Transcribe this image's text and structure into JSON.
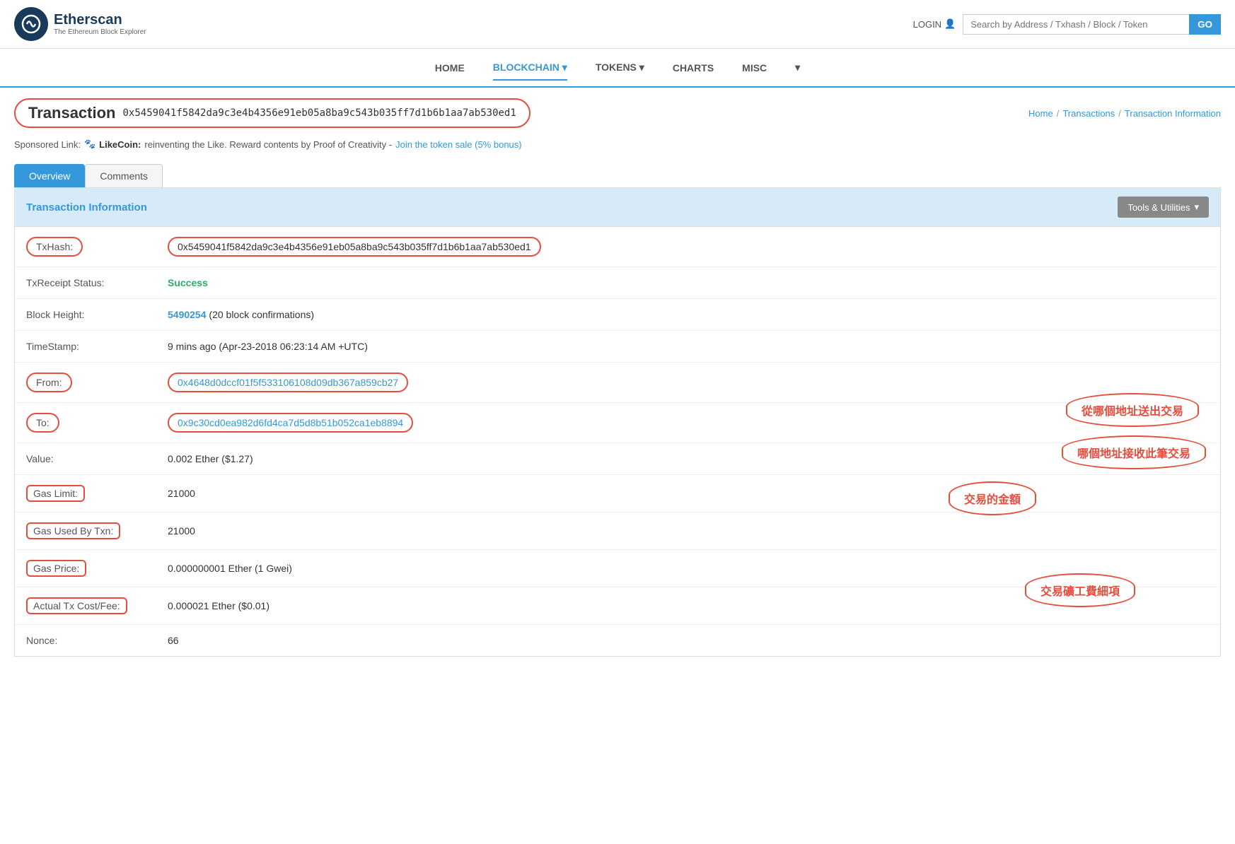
{
  "header": {
    "logo_title": "Etherscan",
    "logo_subtitle": "The Ethereum Block Explorer",
    "login_label": "LOGIN",
    "search_placeholder": "Search by Address / Txhash / Block / Token",
    "search_go": "GO"
  },
  "nav": {
    "items": [
      {
        "label": "HOME",
        "active": false
      },
      {
        "label": "BLOCKCHAIN ▾",
        "active": true
      },
      {
        "label": "TOKENS ▾",
        "active": false
      },
      {
        "label": "CHARTS",
        "active": false
      },
      {
        "label": "MISC",
        "active": false
      },
      {
        "label": "▾",
        "active": false
      }
    ]
  },
  "transaction": {
    "label": "Transaction",
    "hash": "0x5459041f5842da9c3e4b4356e91eb05a8ba9c543b035ff7d1b6b1aa7ab530ed1"
  },
  "breadcrumb": {
    "home": "Home",
    "transactions": "Transactions",
    "current": "Transaction Information"
  },
  "sponsored": {
    "prefix": "Sponsored Link:",
    "coin_name": "LikeCoin:",
    "description": " reinventing the Like. Reward contents by Proof of Creativity -",
    "cta": " Join the token sale (5% bonus)"
  },
  "tabs": [
    {
      "label": "Overview",
      "active": true
    },
    {
      "label": "Comments",
      "active": false
    }
  ],
  "info_panel": {
    "title": "Transaction Information",
    "tools_label": "Tools & Utilities",
    "tools_icon": "▾"
  },
  "tx_fields": {
    "txhash_label": "TxHash:",
    "txhash_value": "0x5459041f5842da9c3e4b4356e91eb05a8ba9c543b035ff7d1b6b1aa7ab530ed1",
    "status_label": "TxReceipt Status:",
    "status_value": "Success",
    "block_label": "Block Height:",
    "block_value": "5490254",
    "block_confirmations": "(20 block confirmations)",
    "timestamp_label": "TimeStamp:",
    "timestamp_value": "9 mins ago (Apr-23-2018 06:23:14 AM +UTC)",
    "from_label": "From:",
    "from_value": "0x4648d0dccf01f5f533106108d09db367a859cb27",
    "to_label": "To:",
    "to_value": "0x9c30cd0ea982d6fd4ca7d5d8b51b052ca1eb8894",
    "value_label": "Value:",
    "value_value": "0.002 Ether ($1.27)",
    "gas_limit_label": "Gas Limit:",
    "gas_limit_value": "21000",
    "gas_used_label": "Gas Used By Txn:",
    "gas_used_value": "21000",
    "gas_price_label": "Gas Price:",
    "gas_price_value": "0.000000001 Ether (1 Gwei)",
    "actual_fee_label": "Actual Tx Cost/Fee:",
    "actual_fee_value": "0.000021 Ether ($0.01)",
    "nonce_label": "Nonce:",
    "nonce_value": "66"
  },
  "annotations": {
    "from_text": "從哪個地址送出交易",
    "to_text": "哪個地址接收此筆交易",
    "value_text": "交易的金額",
    "fee_text": "交易礦工費細項"
  }
}
